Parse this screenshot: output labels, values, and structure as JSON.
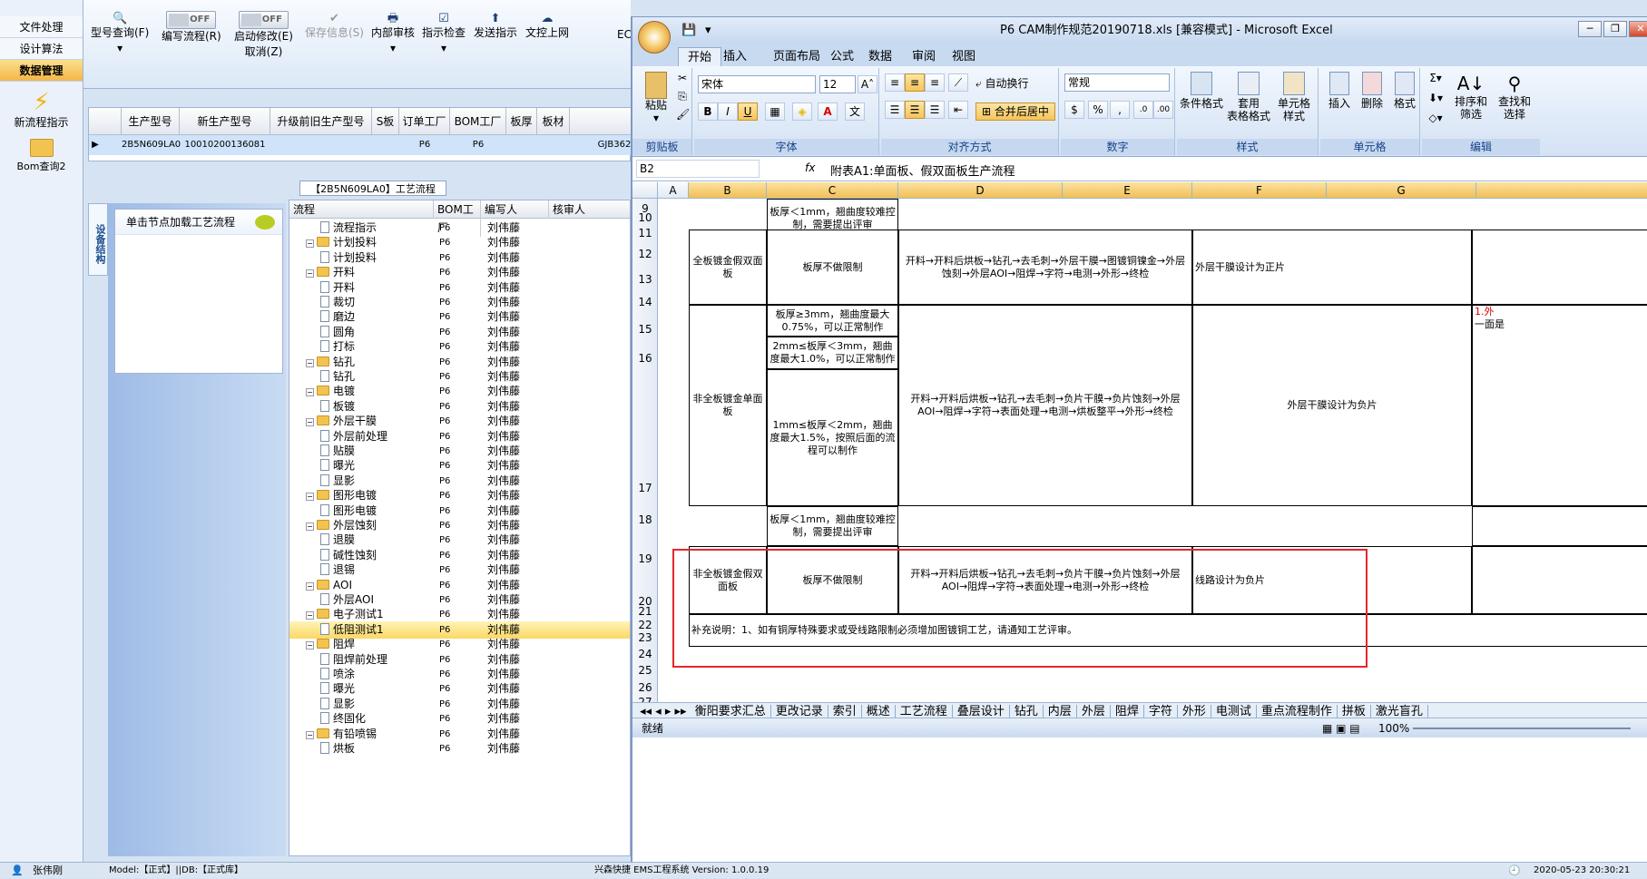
{
  "app": {
    "nav": [
      "文件处理",
      "设计算法",
      "数据管理"
    ],
    "nav_tools": [
      "新流程指示",
      "Bom查询2"
    ],
    "toolbar": {
      "query": "型号查询(F)",
      "edit_flow": "编写流程(R)",
      "toggle1": "OFF",
      "start_modify": "启动修改(E)",
      "cancel": "取消(Z)",
      "toggle2": "OFF",
      "save_info": "保存信息(S)",
      "internal_review": "内部审核",
      "check": "指示检查",
      "send": "发送指示",
      "upload": "文控上网",
      "ec": "EC"
    },
    "grid": {
      "headers": [
        "生产型号",
        "新生产型号",
        "升级前旧生产型号",
        "S板",
        "订单工厂",
        "BOM工厂",
        "板厚",
        "板材"
      ],
      "row": [
        "2B5N609LA0",
        "10010200136081",
        "",
        "",
        "P6",
        "P6",
        "",
        "",
        "GJB362"
      ]
    },
    "flow_tab": "【2B5N609LA0】工艺流程",
    "side_tab": "设备结构",
    "note": "单击节点加载工艺流程",
    "tree_headers": [
      "流程",
      "BOM工厂",
      "编写人",
      "核审人"
    ],
    "tree": [
      {
        "n": "流程指示",
        "l": 2,
        "f": "P6",
        "w": "刘伟藤"
      },
      {
        "n": "计划投料",
        "l": 1,
        "f": "P6",
        "w": "刘伟藤"
      },
      {
        "n": "计划投料",
        "l": 2,
        "f": "P6",
        "w": "刘伟藤"
      },
      {
        "n": "开料",
        "l": 1,
        "f": "P6",
        "w": "刘伟藤"
      },
      {
        "n": "开料",
        "l": 2,
        "f": "P6",
        "w": "刘伟藤"
      },
      {
        "n": "裁切",
        "l": 2,
        "f": "P6",
        "w": "刘伟藤"
      },
      {
        "n": "磨边",
        "l": 2,
        "f": "P6",
        "w": "刘伟藤"
      },
      {
        "n": "圆角",
        "l": 2,
        "f": "P6",
        "w": "刘伟藤"
      },
      {
        "n": "打标",
        "l": 2,
        "f": "P6",
        "w": "刘伟藤"
      },
      {
        "n": "钻孔",
        "l": 1,
        "f": "P6",
        "w": "刘伟藤"
      },
      {
        "n": "钻孔",
        "l": 2,
        "f": "P6",
        "w": "刘伟藤"
      },
      {
        "n": "电镀",
        "l": 1,
        "f": "P6",
        "w": "刘伟藤"
      },
      {
        "n": "板镀",
        "l": 2,
        "f": "P6",
        "w": "刘伟藤"
      },
      {
        "n": "外层干膜",
        "l": 1,
        "f": "P6",
        "w": "刘伟藤"
      },
      {
        "n": "外层前处理",
        "l": 2,
        "f": "P6",
        "w": "刘伟藤"
      },
      {
        "n": "贴膜",
        "l": 2,
        "f": "P6",
        "w": "刘伟藤"
      },
      {
        "n": "曝光",
        "l": 2,
        "f": "P6",
        "w": "刘伟藤"
      },
      {
        "n": "显影",
        "l": 2,
        "f": "P6",
        "w": "刘伟藤"
      },
      {
        "n": "图形电镀",
        "l": 1,
        "f": "P6",
        "w": "刘伟藤"
      },
      {
        "n": "图形电镀",
        "l": 2,
        "f": "P6",
        "w": "刘伟藤"
      },
      {
        "n": "外层蚀刻",
        "l": 1,
        "f": "P6",
        "w": "刘伟藤"
      },
      {
        "n": "退膜",
        "l": 2,
        "f": "P6",
        "w": "刘伟藤"
      },
      {
        "n": "碱性蚀刻",
        "l": 2,
        "f": "P6",
        "w": "刘伟藤"
      },
      {
        "n": "退锡",
        "l": 2,
        "f": "P6",
        "w": "刘伟藤"
      },
      {
        "n": "AOI",
        "l": 1,
        "f": "P6",
        "w": "刘伟藤"
      },
      {
        "n": "外层AOI",
        "l": 2,
        "f": "P6",
        "w": "刘伟藤"
      },
      {
        "n": "电子测试1",
        "l": 1,
        "f": "P6",
        "w": "刘伟藤"
      },
      {
        "n": "低阻测试1",
        "l": 2,
        "f": "P6",
        "w": "刘伟藤",
        "sel": true
      },
      {
        "n": "阻焊",
        "l": 1,
        "f": "P6",
        "w": "刘伟藤"
      },
      {
        "n": "阻焊前处理",
        "l": 2,
        "f": "P6",
        "w": "刘伟藤"
      },
      {
        "n": "喷涂",
        "l": 2,
        "f": "P6",
        "w": "刘伟藤"
      },
      {
        "n": "曝光",
        "l": 2,
        "f": "P6",
        "w": "刘伟藤"
      },
      {
        "n": "显影",
        "l": 2,
        "f": "P6",
        "w": "刘伟藤"
      },
      {
        "n": "终固化",
        "l": 2,
        "f": "P6",
        "w": "刘伟藤"
      },
      {
        "n": "有铅喷锡",
        "l": 1,
        "f": "P6",
        "w": "刘伟藤"
      },
      {
        "n": "烘板",
        "l": 2,
        "f": "P6",
        "w": "刘伟藤"
      }
    ],
    "status": {
      "user": "张伟刚",
      "model": "Model:【正式】||DB:【正式库】",
      "system": "兴森快捷 EMS工程系统 Version: 1.0.0.19",
      "time": "2020-05-23 20:30:21"
    }
  },
  "excel": {
    "title": "P6 CAM制作规范20190718.xls [兼容模式] - Microsoft Excel",
    "tabs": [
      "开始",
      "插入",
      "页面布局",
      "公式",
      "数据",
      "审阅",
      "视图"
    ],
    "groups": [
      "剪贴板",
      "字体",
      "对齐方式",
      "数字",
      "样式",
      "单元格",
      "编辑"
    ],
    "paste": "粘贴",
    "font_name": "宋体",
    "font_size": "12",
    "wrap": "自动换行",
    "merge": "合并后居中",
    "number_format": "常规",
    "style_btns": [
      "条件格式",
      "套用\n表格格式",
      "单元格\n样式"
    ],
    "cell_btns": [
      "插入",
      "删除",
      "格式"
    ],
    "edit_btns": [
      "排序和\n筛选",
      "查找和\n选择"
    ],
    "name_box": "B2",
    "formula": "附表A1:单面板、假双面板生产流程",
    "columns": [
      "A",
      "B",
      "C",
      "D",
      "E",
      "F",
      "G"
    ],
    "rows": [
      "9",
      "10",
      "11",
      "12",
      "13",
      "14",
      "15",
      "16",
      "17",
      "18",
      "19",
      "20",
      "21",
      "22",
      "23",
      "24",
      "25",
      "26",
      "27"
    ],
    "cells": {
      "c9": "板厚＜1mm，翘曲度较难控制，需要提出评审",
      "b11": "全板镀金假双面板",
      "c11": "板厚不做限制",
      "d11": "开料→开料后烘板→钻孔→去毛刺→外层干膜→图镀铜镍金→外层蚀刻→外层AOI→阻焊→字符→电测→外形→终检",
      "f11": "外层干膜设计为正片",
      "c14": "板厚≥3mm，翘曲度最大0.75%，可以正常制作",
      "c15": "2mm≤板厚＜3mm，翘曲度最大1.0%，可以正常制作",
      "b16": "非全板镀金单面板",
      "c16": "1mm≤板厚＜2mm，翘曲度最大1.5%，按照后面的流程可以制作",
      "d16": "开料→开料后烘板→钻孔→去毛刺→负片干膜→负片蚀刻→外层AOI→阻焊→字符→表面处理→电测→烘板整平→外形→终检",
      "f16": "外层干膜设计为负片",
      "h16": "1.外",
      "h16b": "一面是",
      "c17": "板厚＜1mm，翘曲度较难控制，需要提出评审",
      "b18": "非全板镀金假双面板",
      "c18": "板厚不做限制",
      "d18": "开料→开料后烘板→钻孔→去毛刺→负片干膜→负片蚀刻→外层AOI→阻焊→字符→表面处理→电测→外形→终检",
      "f18": "线路设计为负片",
      "b20": "补充说明：1、如有铜厚特殊要求或受线路限制必须增加图镀铜工艺，请通知工艺评审。"
    },
    "sheet_tabs": [
      "衡阳要求汇总",
      "更改记录",
      "索引",
      "概述",
      "工艺流程",
      "叠层设计",
      "钻孔",
      "内层",
      "外层",
      "阻焊",
      "字符",
      "外形",
      "电测试",
      "重点流程制作",
      "拼板",
      "激光盲孔"
    ],
    "status_ready": "就绪",
    "zoom": "100%"
  }
}
